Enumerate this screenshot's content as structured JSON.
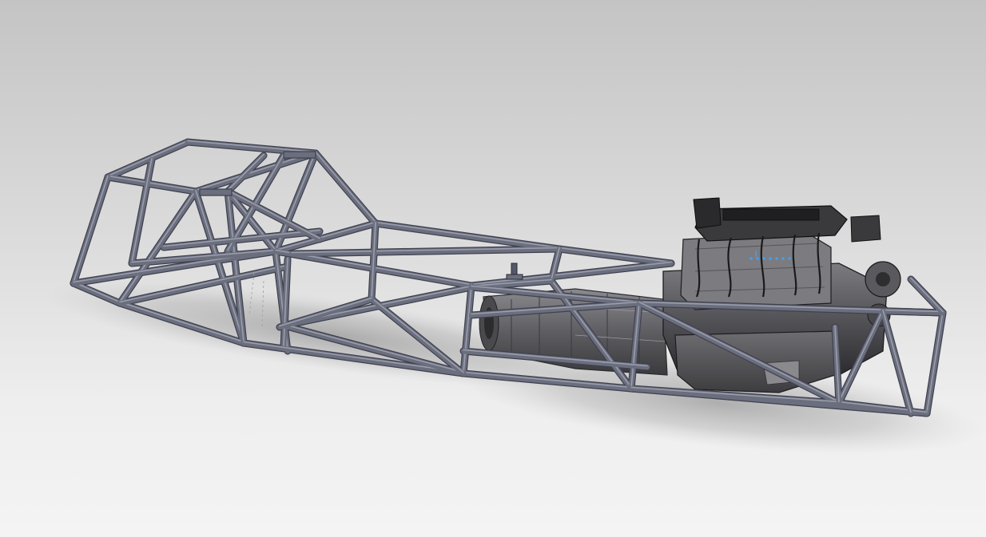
{
  "viewport": {
    "kind": "cad-3d-viewport",
    "text": []
  },
  "model": {
    "parts": [
      "tube-frame-chassis",
      "engine",
      "transmission",
      "oil-pan",
      "valve-covers",
      "intake-manifold",
      "ignition-wires"
    ]
  },
  "colors": {
    "frame_tube": "#6b6e7d",
    "frame_tube_light": "#9a9dab",
    "frame_tube_dark": "#3f4150",
    "engine_dark": "#2a2a2c",
    "engine_mid": "#5a5a5e",
    "engine_light": "#8a8a8e",
    "shadow": "#8c8c8c",
    "highlight_blue": "#3fa3ff"
  }
}
